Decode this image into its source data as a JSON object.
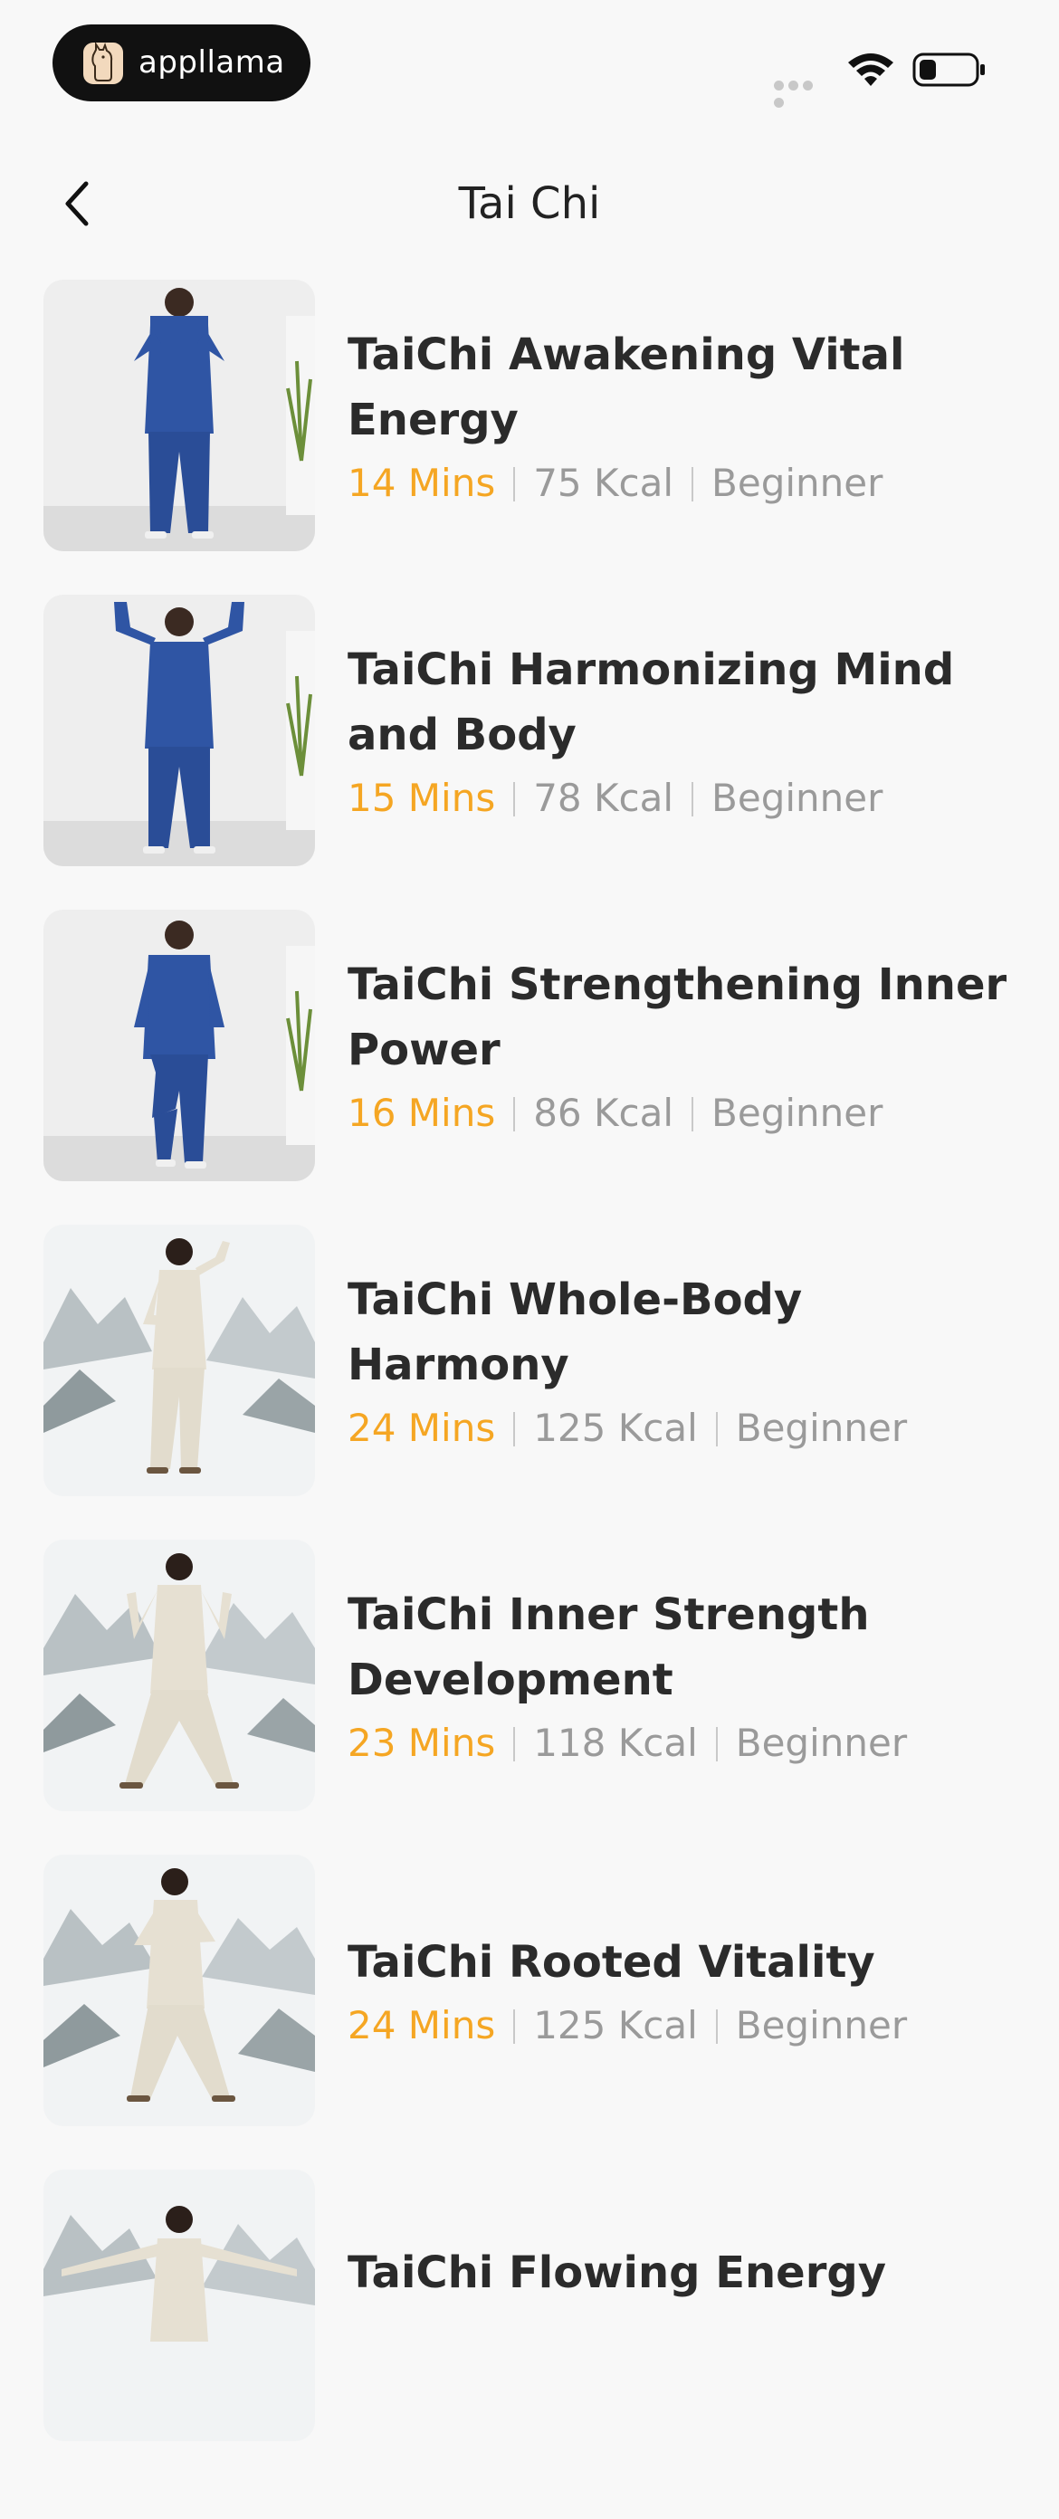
{
  "status_bar": {
    "brand": "appllama",
    "icons": [
      "signal-dots",
      "wifi-icon",
      "battery-icon"
    ]
  },
  "header": {
    "title": "Tai Chi",
    "back_icon": "chevron-left-icon"
  },
  "colors": {
    "accent": "#f5a623",
    "title": "#2b2b2b",
    "meta": "#9a9a9a",
    "background": "#f8f8f8",
    "outfit_blue": "#2f55a4",
    "outfit_cream": "#e6e0d2"
  },
  "workouts": [
    {
      "title": "TaiChi Awakening Vital Energy",
      "duration": "14 Mins",
      "calories": "75 Kcal",
      "level": "Beginner"
    },
    {
      "title": "TaiChi Harmonizing Mind and Body",
      "duration": "15 Mins",
      "calories": "78 Kcal",
      "level": "Beginner"
    },
    {
      "title": "TaiChi Strengthening Inner Power",
      "duration": "16 Mins",
      "calories": "86 Kcal",
      "level": "Beginner"
    },
    {
      "title": "TaiChi Whole-Body Harmony",
      "duration": "24 Mins",
      "calories": "125 Kcal",
      "level": "Beginner"
    },
    {
      "title": "TaiChi Inner Strength Development",
      "duration": "23 Mins",
      "calories": "118 Kcal",
      "level": "Beginner"
    },
    {
      "title": "TaiChi Rooted Vitality",
      "duration": "24 Mins",
      "calories": "125 Kcal",
      "level": "Beginner"
    },
    {
      "title": "TaiChi Flowing Energy",
      "duration": "",
      "calories": "",
      "level": ""
    }
  ]
}
